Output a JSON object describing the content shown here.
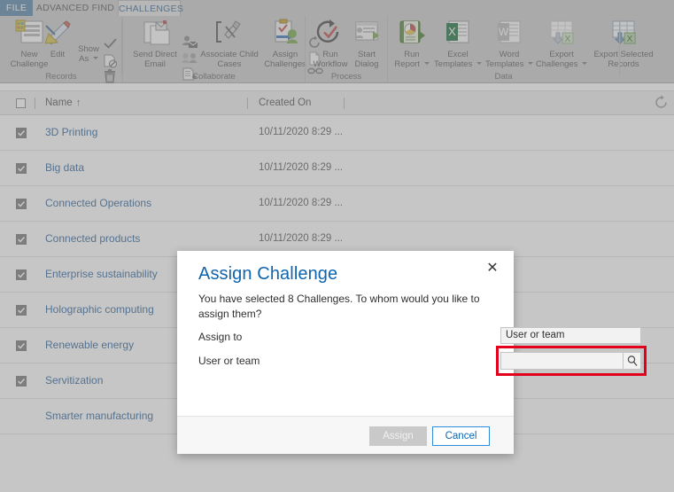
{
  "tabs": {
    "file": "FILE",
    "advanced_find": "ADVANCED FIND",
    "challenges": "CHALLENGES",
    "ghost_right": "......  ......"
  },
  "ribbon": {
    "groups": [
      {
        "label": "Records",
        "buttons": [
          {
            "name": "new-challenge-button",
            "label": "New\nChallenge",
            "line1": "New",
            "line2": "Challenge"
          },
          {
            "name": "edit-button",
            "label": "Edit",
            "line1": "Edit",
            "line2": ""
          },
          {
            "name": "show-as-button",
            "line1": "Show",
            "line2": "As "
          }
        ],
        "small_buttons": [
          {
            "name": "activate-icon",
            "icon": "checkmark-icon"
          },
          {
            "name": "deactivate-icon",
            "icon": "document-block-icon"
          },
          {
            "name": "delete-icon",
            "icon": "trash-icon"
          }
        ]
      },
      {
        "label": "Collaborate",
        "buttons": [
          {
            "name": "send-direct-email-button",
            "line1": "Send Direct",
            "line2": "Email"
          },
          {
            "name": "associate-child-cases-button",
            "line1": "Associate Child",
            "line2": "Cases"
          },
          {
            "name": "assign-challenges-button",
            "line1": "Assign",
            "line2": "Challenges"
          }
        ],
        "small_buttons": [
          {
            "name": "share-email-icon",
            "icon": "person-mail-icon"
          },
          {
            "name": "share-people-icon",
            "icon": "people-icon"
          },
          {
            "name": "add-note-icon",
            "icon": "note-add-icon"
          },
          {
            "name": "connect-icon",
            "icon": "link-icon"
          },
          {
            "name": "copy-link-icon",
            "icon": "page-icon"
          },
          {
            "name": "refresh-all-icon",
            "icon": "circular-arrow-icon"
          }
        ]
      },
      {
        "label": "Process",
        "buttons": [
          {
            "name": "run-workflow-button",
            "line1": "Run",
            "line2": "Workflow"
          },
          {
            "name": "start-dialog-button",
            "line1": "Start",
            "line2": "Dialog"
          }
        ]
      },
      {
        "label": "Data",
        "buttons": [
          {
            "name": "run-report-button",
            "line1": "Run",
            "line2": "Report "
          },
          {
            "name": "excel-templates-button",
            "line1": "Excel",
            "line2": "Templates "
          },
          {
            "name": "word-templates-button",
            "line1": "Word",
            "line2": "Templates "
          },
          {
            "name": "export-challenges-button",
            "line1": "Export",
            "line2": "Challenges "
          },
          {
            "name": "export-selected-records-button",
            "line1": "Export Selected",
            "line2": "Records"
          }
        ]
      }
    ]
  },
  "grid": {
    "columns": [
      {
        "key": "name",
        "label": "Name",
        "sort": "↑"
      },
      {
        "key": "created_on",
        "label": "Created On",
        "sort": ""
      }
    ],
    "refresh_icon": "refresh-icon",
    "rows": [
      {
        "name": "3D Printing",
        "created_on": "10/11/2020 8:29 ...",
        "selected": true
      },
      {
        "name": "Big data",
        "created_on": "10/11/2020 8:29 ...",
        "selected": true
      },
      {
        "name": "Connected Operations",
        "created_on": "10/11/2020 8:29 ...",
        "selected": true
      },
      {
        "name": "Connected products",
        "created_on": "10/11/2020 8:29 ...",
        "selected": true
      },
      {
        "name": "Enterprise sustainability",
        "created_on": "10/11/2020 8:29 ...",
        "selected": true
      },
      {
        "name": "Holographic computing",
        "created_on": "",
        "selected": true
      },
      {
        "name": "Renewable energy",
        "created_on": "",
        "selected": true
      },
      {
        "name": "Servitization",
        "created_on": "",
        "selected": true
      },
      {
        "name": "Smarter manufacturing",
        "created_on": "",
        "selected": false
      }
    ]
  },
  "dialog": {
    "title": "Assign Challenge",
    "close_label": "✕",
    "description": "You have selected 8 Challenges. To whom would you like to assign them?",
    "assign_to_label": "Assign to",
    "assign_to_value": "User or team",
    "user_or_team_label": "User or team",
    "user_or_team_value": "",
    "lookup_icon": "search-icon",
    "assign_button": "Assign",
    "cancel_button": "Cancel",
    "highlight_color": "#e2001a"
  },
  "colors": {
    "tab_file_bg": "#5c87ab",
    "link": "#30679e",
    "dialog_title": "#1064ad",
    "accent_blue": "#2f8ddc"
  }
}
